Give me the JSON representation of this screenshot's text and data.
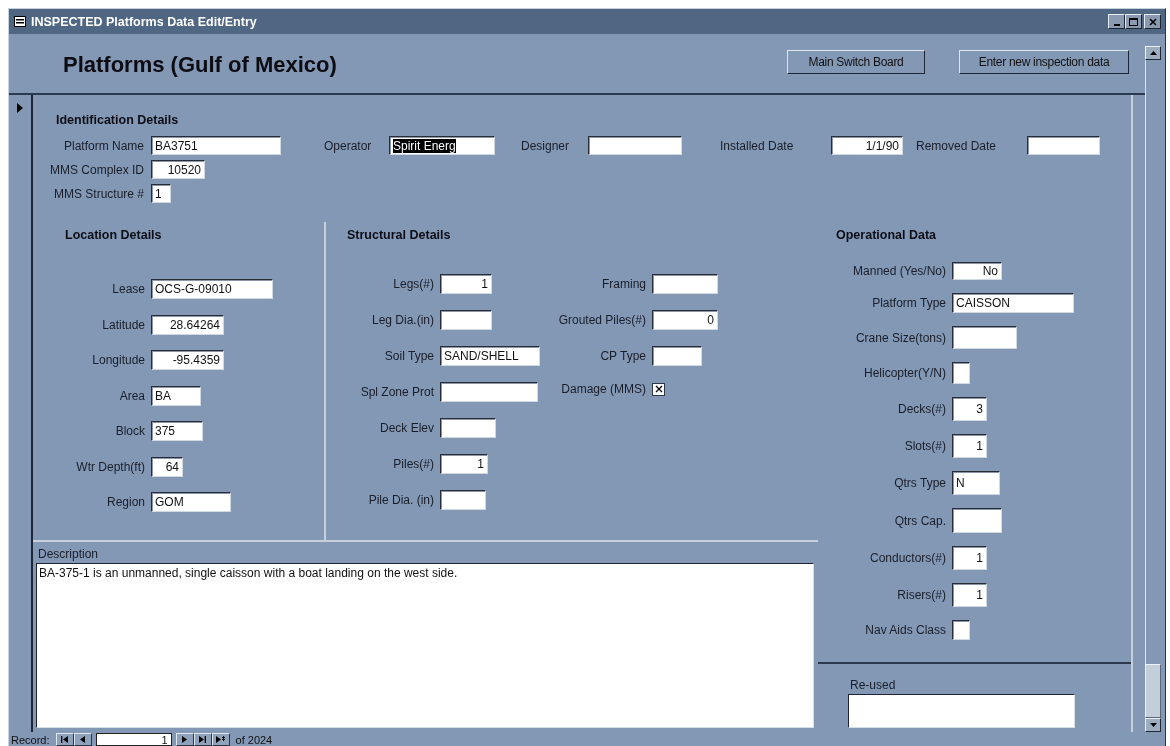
{
  "window": {
    "title": "INSPECTED Platforms Data Edit/Entry"
  },
  "header": {
    "title": "Platforms (Gulf of Mexico)",
    "buttons": [
      "Main Switch Board",
      "Enter new inspection data"
    ]
  },
  "record_selector": {
    "current": true
  },
  "identification": {
    "heading": "Identification Details",
    "rows": [
      [
        {
          "label": "Platform Name",
          "value": "BA3751",
          "numeric": false,
          "highlighted": false
        },
        {
          "label": "Operator",
          "value": "Spirit Energ",
          "numeric": false,
          "highlighted": true
        },
        {
          "label": "Designer"
        },
        {
          "label": "Installed Date",
          "value": "1/1/90",
          "numeric": true,
          "highlighted": false
        },
        {
          "label": "Removed Date"
        }
      ],
      [
        {
          "label": "MMS Complex ID",
          "value": "10520",
          "numeric": true,
          "highlighted": false
        }
      ],
      [
        {
          "label": "MMS Structure #",
          "value": "1",
          "numeric": false,
          "highlighted": false
        }
      ]
    ]
  },
  "location": {
    "heading": "Location Details",
    "fields": [
      {
        "label": "Lease",
        "value": "OCS-G-09010",
        "numeric": false
      },
      {
        "label": "Latitude",
        "value": "28.64264",
        "numeric": true
      },
      {
        "label": "Longitude",
        "value": "-95.4359",
        "numeric": true
      },
      {
        "label": "Area",
        "value": "BA",
        "numeric": false
      },
      {
        "label": "Block",
        "value": "375",
        "numeric": false
      },
      {
        "label": "Wtr Depth(ft)",
        "value": "64",
        "numeric": true
      },
      {
        "label": "Region",
        "value": "GOM",
        "numeric": false
      }
    ]
  },
  "structural": {
    "heading": "Structural Details",
    "fields_left": [
      {
        "label": "Legs(#)",
        "value": "1",
        "numeric": true
      },
      {
        "label": "Leg Dia.(in)"
      },
      {
        "label": "Soil Type",
        "value": "SAND/SHELL",
        "numeric": false
      },
      {
        "label": "Spl Zone Prot"
      },
      {
        "label": "Deck Elev"
      },
      {
        "label": "Piles(#)",
        "value": "1",
        "numeric": true
      },
      {
        "label": "Pile Dia. (in)"
      }
    ],
    "fields_right": [
      {
        "kind": "text",
        "label": "Framing"
      },
      {
        "kind": "text",
        "label": "Grouted Piles(#)",
        "value": "0",
        "numeric": true
      },
      {
        "kind": "text",
        "label": "CP Type"
      },
      {
        "kind": "checkbox",
        "label": "Damage (MMS)",
        "checked": true
      }
    ]
  },
  "operational": {
    "heading": "Operational Data",
    "fields": [
      {
        "label": "Manned (Yes/No)",
        "value": "No",
        "numeric": true
      },
      {
        "label": "Platform Type",
        "value": "CAISSON",
        "numeric": false
      },
      {
        "label": "Crane Size(tons)"
      },
      {
        "label": "Helicopter(Y/N)"
      },
      {
        "label": "Decks(#)",
        "value": "3",
        "numeric": true
      },
      {
        "label": "Slots(#)",
        "value": "1",
        "numeric": true
      },
      {
        "label": "Qtrs Type",
        "value": "N",
        "numeric": false
      },
      {
        "label": "Qtrs Cap."
      },
      {
        "label": "Conductors(#)",
        "value": "1",
        "numeric": true
      },
      {
        "label": "Risers(#)",
        "value": "1",
        "numeric": true
      },
      {
        "label": "Nav Aids Class"
      }
    ]
  },
  "description": {
    "label": "Description",
    "value": "BA-375-1 is an unmanned, single caisson with a boat landing on the west side."
  },
  "reused": {
    "label": "Re-used"
  },
  "record_nav": {
    "label": "Record:",
    "current": "1",
    "total": "of 2024"
  }
}
